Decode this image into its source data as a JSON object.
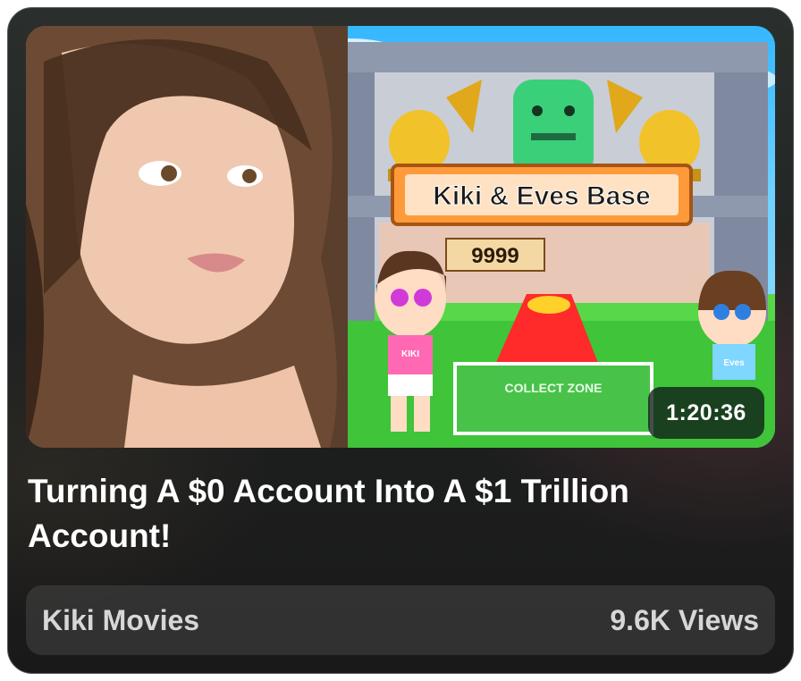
{
  "video": {
    "thumbnail_sign": "Kiki & Eves Base",
    "thumbnail_zone_label": "COLLECT ZONE",
    "thumbnail_shirt_left": "KIKI",
    "thumbnail_shirt_right": "Eves",
    "thumbnail_counter": "9999",
    "duration": "1:20:36",
    "title": "Turning A $0 Account Into A $1 Trillion Account!",
    "channel": "Kiki Movies",
    "views": "9.6K Views"
  },
  "colors": {
    "card_bg": "#1d1f1f",
    "footer_bg": "#3a3a3a",
    "text_primary": "#ffffff",
    "text_secondary": "#d7d7d7",
    "sign_orange": "#f08a2a"
  }
}
